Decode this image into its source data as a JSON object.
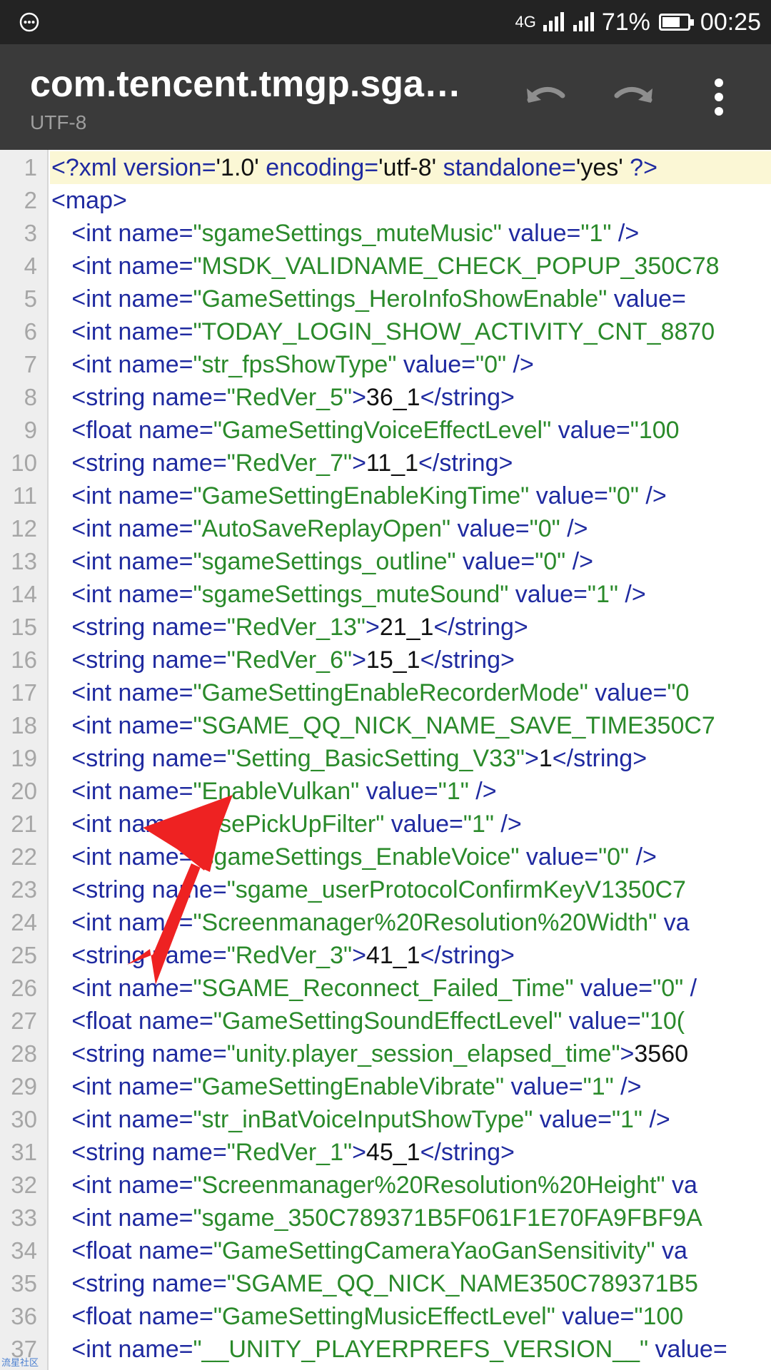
{
  "status_bar": {
    "network": "4G",
    "battery_percent": "71%",
    "battery_level": 0.71,
    "time": "00:25"
  },
  "toolbar": {
    "title": "com.tencent.tmgp.sgam…",
    "subtitle": "UTF-8"
  },
  "editor": {
    "active_line": 1,
    "lines": [
      {
        "n": "1",
        "segs": [
          {
            "c": "tag",
            "t": "<?xml version="
          },
          {
            "c": "txt",
            "t": "'1.0' "
          },
          {
            "c": "tag",
            "t": "encoding="
          },
          {
            "c": "txt",
            "t": "'utf-8' "
          },
          {
            "c": "tag",
            "t": "standalone="
          },
          {
            "c": "txt",
            "t": "'yes' "
          },
          {
            "c": "tag",
            "t": "?>"
          }
        ]
      },
      {
        "n": "2",
        "segs": [
          {
            "c": "tag",
            "t": "<map>"
          }
        ]
      },
      {
        "n": "3",
        "segs": [
          {
            "c": "tag",
            "t": "   <int name="
          },
          {
            "c": "str",
            "t": "\"sgameSettings_muteMusic\""
          },
          {
            "c": "tag",
            "t": " value="
          },
          {
            "c": "str",
            "t": "\"1\""
          },
          {
            "c": "tag",
            "t": " />"
          }
        ]
      },
      {
        "n": "4",
        "segs": [
          {
            "c": "tag",
            "t": "   <int name="
          },
          {
            "c": "str",
            "t": "\"MSDK_VALIDNAME_CHECK_POPUP_350C78"
          }
        ]
      },
      {
        "n": "5",
        "segs": [
          {
            "c": "tag",
            "t": "   <int name="
          },
          {
            "c": "str",
            "t": "\"GameSettings_HeroInfoShowEnable\""
          },
          {
            "c": "tag",
            "t": " value="
          }
        ]
      },
      {
        "n": "6",
        "segs": [
          {
            "c": "tag",
            "t": "   <int name="
          },
          {
            "c": "str",
            "t": "\"TODAY_LOGIN_SHOW_ACTIVITY_CNT_8870"
          }
        ]
      },
      {
        "n": "7",
        "segs": [
          {
            "c": "tag",
            "t": "   <int name="
          },
          {
            "c": "str",
            "t": "\"str_fpsShowType\""
          },
          {
            "c": "tag",
            "t": " value="
          },
          {
            "c": "str",
            "t": "\"0\""
          },
          {
            "c": "tag",
            "t": " />"
          }
        ]
      },
      {
        "n": "8",
        "segs": [
          {
            "c": "tag",
            "t": "   <string name="
          },
          {
            "c": "str",
            "t": "\"RedVer_5\""
          },
          {
            "c": "tag",
            "t": ">"
          },
          {
            "c": "txt",
            "t": "36_1"
          },
          {
            "c": "tag",
            "t": "</string>"
          }
        ]
      },
      {
        "n": "9",
        "segs": [
          {
            "c": "tag",
            "t": "   <float name="
          },
          {
            "c": "str",
            "t": "\"GameSettingVoiceEffectLevel\""
          },
          {
            "c": "tag",
            "t": " value="
          },
          {
            "c": "str",
            "t": "\"100"
          }
        ]
      },
      {
        "n": "10",
        "segs": [
          {
            "c": "tag",
            "t": "   <string name="
          },
          {
            "c": "str",
            "t": "\"RedVer_7\""
          },
          {
            "c": "tag",
            "t": ">"
          },
          {
            "c": "txt",
            "t": "11_1"
          },
          {
            "c": "tag",
            "t": "</string>"
          }
        ]
      },
      {
        "n": "11",
        "segs": [
          {
            "c": "tag",
            "t": "   <int name="
          },
          {
            "c": "str",
            "t": "\"GameSettingEnableKingTime\""
          },
          {
            "c": "tag",
            "t": " value="
          },
          {
            "c": "str",
            "t": "\"0\""
          },
          {
            "c": "tag",
            "t": " />"
          }
        ]
      },
      {
        "n": "12",
        "segs": [
          {
            "c": "tag",
            "t": "   <int name="
          },
          {
            "c": "str",
            "t": "\"AutoSaveReplayOpen\""
          },
          {
            "c": "tag",
            "t": " value="
          },
          {
            "c": "str",
            "t": "\"0\""
          },
          {
            "c": "tag",
            "t": " />"
          }
        ]
      },
      {
        "n": "13",
        "segs": [
          {
            "c": "tag",
            "t": "   <int name="
          },
          {
            "c": "str",
            "t": "\"sgameSettings_outline\""
          },
          {
            "c": "tag",
            "t": " value="
          },
          {
            "c": "str",
            "t": "\"0\""
          },
          {
            "c": "tag",
            "t": " />"
          }
        ]
      },
      {
        "n": "14",
        "segs": [
          {
            "c": "tag",
            "t": "   <int name="
          },
          {
            "c": "str",
            "t": "\"sgameSettings_muteSound\""
          },
          {
            "c": "tag",
            "t": " value="
          },
          {
            "c": "str",
            "t": "\"1\""
          },
          {
            "c": "tag",
            "t": " />"
          }
        ]
      },
      {
        "n": "15",
        "segs": [
          {
            "c": "tag",
            "t": "   <string name="
          },
          {
            "c": "str",
            "t": "\"RedVer_13\""
          },
          {
            "c": "tag",
            "t": ">"
          },
          {
            "c": "txt",
            "t": "21_1"
          },
          {
            "c": "tag",
            "t": "</string>"
          }
        ]
      },
      {
        "n": "16",
        "segs": [
          {
            "c": "tag",
            "t": "   <string name="
          },
          {
            "c": "str",
            "t": "\"RedVer_6\""
          },
          {
            "c": "tag",
            "t": ">"
          },
          {
            "c": "txt",
            "t": "15_1"
          },
          {
            "c": "tag",
            "t": "</string>"
          }
        ]
      },
      {
        "n": "17",
        "segs": [
          {
            "c": "tag",
            "t": "   <int name="
          },
          {
            "c": "str",
            "t": "\"GameSettingEnableRecorderMode\""
          },
          {
            "c": "tag",
            "t": " value="
          },
          {
            "c": "str",
            "t": "\"0"
          }
        ]
      },
      {
        "n": "18",
        "segs": [
          {
            "c": "tag",
            "t": "   <int name="
          },
          {
            "c": "str",
            "t": "\"SGAME_QQ_NICK_NAME_SAVE_TIME350C7"
          }
        ]
      },
      {
        "n": "19",
        "segs": [
          {
            "c": "tag",
            "t": "   <string name="
          },
          {
            "c": "str",
            "t": "\"Setting_BasicSetting_V33\""
          },
          {
            "c": "tag",
            "t": ">"
          },
          {
            "c": "txt",
            "t": "1"
          },
          {
            "c": "tag",
            "t": "</string>"
          }
        ]
      },
      {
        "n": "20",
        "segs": [
          {
            "c": "tag",
            "t": "   <int name="
          },
          {
            "c": "str",
            "t": "\"EnableVulkan\""
          },
          {
            "c": "tag",
            "t": " value="
          },
          {
            "c": "str",
            "t": "\"1\""
          },
          {
            "c": "tag",
            "t": " />"
          }
        ]
      },
      {
        "n": "21",
        "segs": [
          {
            "c": "tag",
            "t": "   <int name="
          },
          {
            "c": "str",
            "t": "\"UsePickUpFilter\""
          },
          {
            "c": "tag",
            "t": " value="
          },
          {
            "c": "str",
            "t": "\"1\""
          },
          {
            "c": "tag",
            "t": " />"
          }
        ]
      },
      {
        "n": "22",
        "segs": [
          {
            "c": "tag",
            "t": "   <int name="
          },
          {
            "c": "str",
            "t": "\"sgameSettings_EnableVoice\""
          },
          {
            "c": "tag",
            "t": " value="
          },
          {
            "c": "str",
            "t": "\"0\""
          },
          {
            "c": "tag",
            "t": " />"
          }
        ]
      },
      {
        "n": "23",
        "segs": [
          {
            "c": "tag",
            "t": "   <string name="
          },
          {
            "c": "str",
            "t": "\"sgame_userProtocolConfirmKeyV1350C7"
          }
        ]
      },
      {
        "n": "24",
        "segs": [
          {
            "c": "tag",
            "t": "   <int name="
          },
          {
            "c": "str",
            "t": "\"Screenmanager%20Resolution%20Width\""
          },
          {
            "c": "tag",
            "t": " va"
          }
        ]
      },
      {
        "n": "25",
        "segs": [
          {
            "c": "tag",
            "t": "   <string name="
          },
          {
            "c": "str",
            "t": "\"RedVer_3\""
          },
          {
            "c": "tag",
            "t": ">"
          },
          {
            "c": "txt",
            "t": "41_1"
          },
          {
            "c": "tag",
            "t": "</string>"
          }
        ]
      },
      {
        "n": "26",
        "segs": [
          {
            "c": "tag",
            "t": "   <int name="
          },
          {
            "c": "str",
            "t": "\"SGAME_Reconnect_Failed_Time\""
          },
          {
            "c": "tag",
            "t": " value="
          },
          {
            "c": "str",
            "t": "\"0\""
          },
          {
            "c": "tag",
            "t": " /"
          }
        ]
      },
      {
        "n": "27",
        "segs": [
          {
            "c": "tag",
            "t": "   <float name="
          },
          {
            "c": "str",
            "t": "\"GameSettingSoundEffectLevel\""
          },
          {
            "c": "tag",
            "t": " value="
          },
          {
            "c": "str",
            "t": "\"10("
          }
        ]
      },
      {
        "n": "28",
        "segs": [
          {
            "c": "tag",
            "t": "   <string name="
          },
          {
            "c": "str",
            "t": "\"unity.player_session_elapsed_time\""
          },
          {
            "c": "tag",
            "t": ">"
          },
          {
            "c": "txt",
            "t": "3560"
          }
        ]
      },
      {
        "n": "29",
        "segs": [
          {
            "c": "tag",
            "t": "   <int name="
          },
          {
            "c": "str",
            "t": "\"GameSettingEnableVibrate\""
          },
          {
            "c": "tag",
            "t": " value="
          },
          {
            "c": "str",
            "t": "\"1\""
          },
          {
            "c": "tag",
            "t": " />"
          }
        ]
      },
      {
        "n": "30",
        "segs": [
          {
            "c": "tag",
            "t": "   <int name="
          },
          {
            "c": "str",
            "t": "\"str_inBatVoiceInputShowType\""
          },
          {
            "c": "tag",
            "t": " value="
          },
          {
            "c": "str",
            "t": "\"1\""
          },
          {
            "c": "tag",
            "t": " />"
          }
        ]
      },
      {
        "n": "31",
        "segs": [
          {
            "c": "tag",
            "t": "   <string name="
          },
          {
            "c": "str",
            "t": "\"RedVer_1\""
          },
          {
            "c": "tag",
            "t": ">"
          },
          {
            "c": "txt",
            "t": "45_1"
          },
          {
            "c": "tag",
            "t": "</string>"
          }
        ]
      },
      {
        "n": "32",
        "segs": [
          {
            "c": "tag",
            "t": "   <int name="
          },
          {
            "c": "str",
            "t": "\"Screenmanager%20Resolution%20Height\""
          },
          {
            "c": "tag",
            "t": " va"
          }
        ]
      },
      {
        "n": "33",
        "segs": [
          {
            "c": "tag",
            "t": "   <int name="
          },
          {
            "c": "str",
            "t": "\"sgame_350C789371B5F061F1E70FA9FBF9A"
          }
        ]
      },
      {
        "n": "34",
        "segs": [
          {
            "c": "tag",
            "t": "   <float name="
          },
          {
            "c": "str",
            "t": "\"GameSettingCameraYaoGanSensitivity\""
          },
          {
            "c": "tag",
            "t": " va"
          }
        ]
      },
      {
        "n": "35",
        "segs": [
          {
            "c": "tag",
            "t": "   <string name="
          },
          {
            "c": "str",
            "t": "\"SGAME_QQ_NICK_NAME350C789371B5"
          }
        ]
      },
      {
        "n": "36",
        "segs": [
          {
            "c": "tag",
            "t": "   <float name="
          },
          {
            "c": "str",
            "t": "\"GameSettingMusicEffectLevel\""
          },
          {
            "c": "tag",
            "t": " value="
          },
          {
            "c": "str",
            "t": "\"100"
          }
        ]
      },
      {
        "n": "37",
        "segs": [
          {
            "c": "tag",
            "t": "   <int name="
          },
          {
            "c": "str",
            "t": "\"__UNITY_PLAYERPREFS_VERSION__\""
          },
          {
            "c": "tag",
            "t": " value="
          }
        ]
      }
    ]
  },
  "watermark": "流星社区",
  "colors": {
    "status_bar_bg": "#232323",
    "toolbar_bg": "#3a3a3a",
    "tag": "#1f2aa0",
    "string": "#2a8a2a",
    "text": "#111111",
    "active_line_bg": "#fbf7d5",
    "annotation_arrow": "#ee2222"
  },
  "icons": {
    "status_left": "chat-bubble-icon",
    "undo": "undo-icon",
    "redo": "redo-icon",
    "more": "more-vert-icon",
    "signal": "signal-icon",
    "battery": "battery-icon"
  }
}
